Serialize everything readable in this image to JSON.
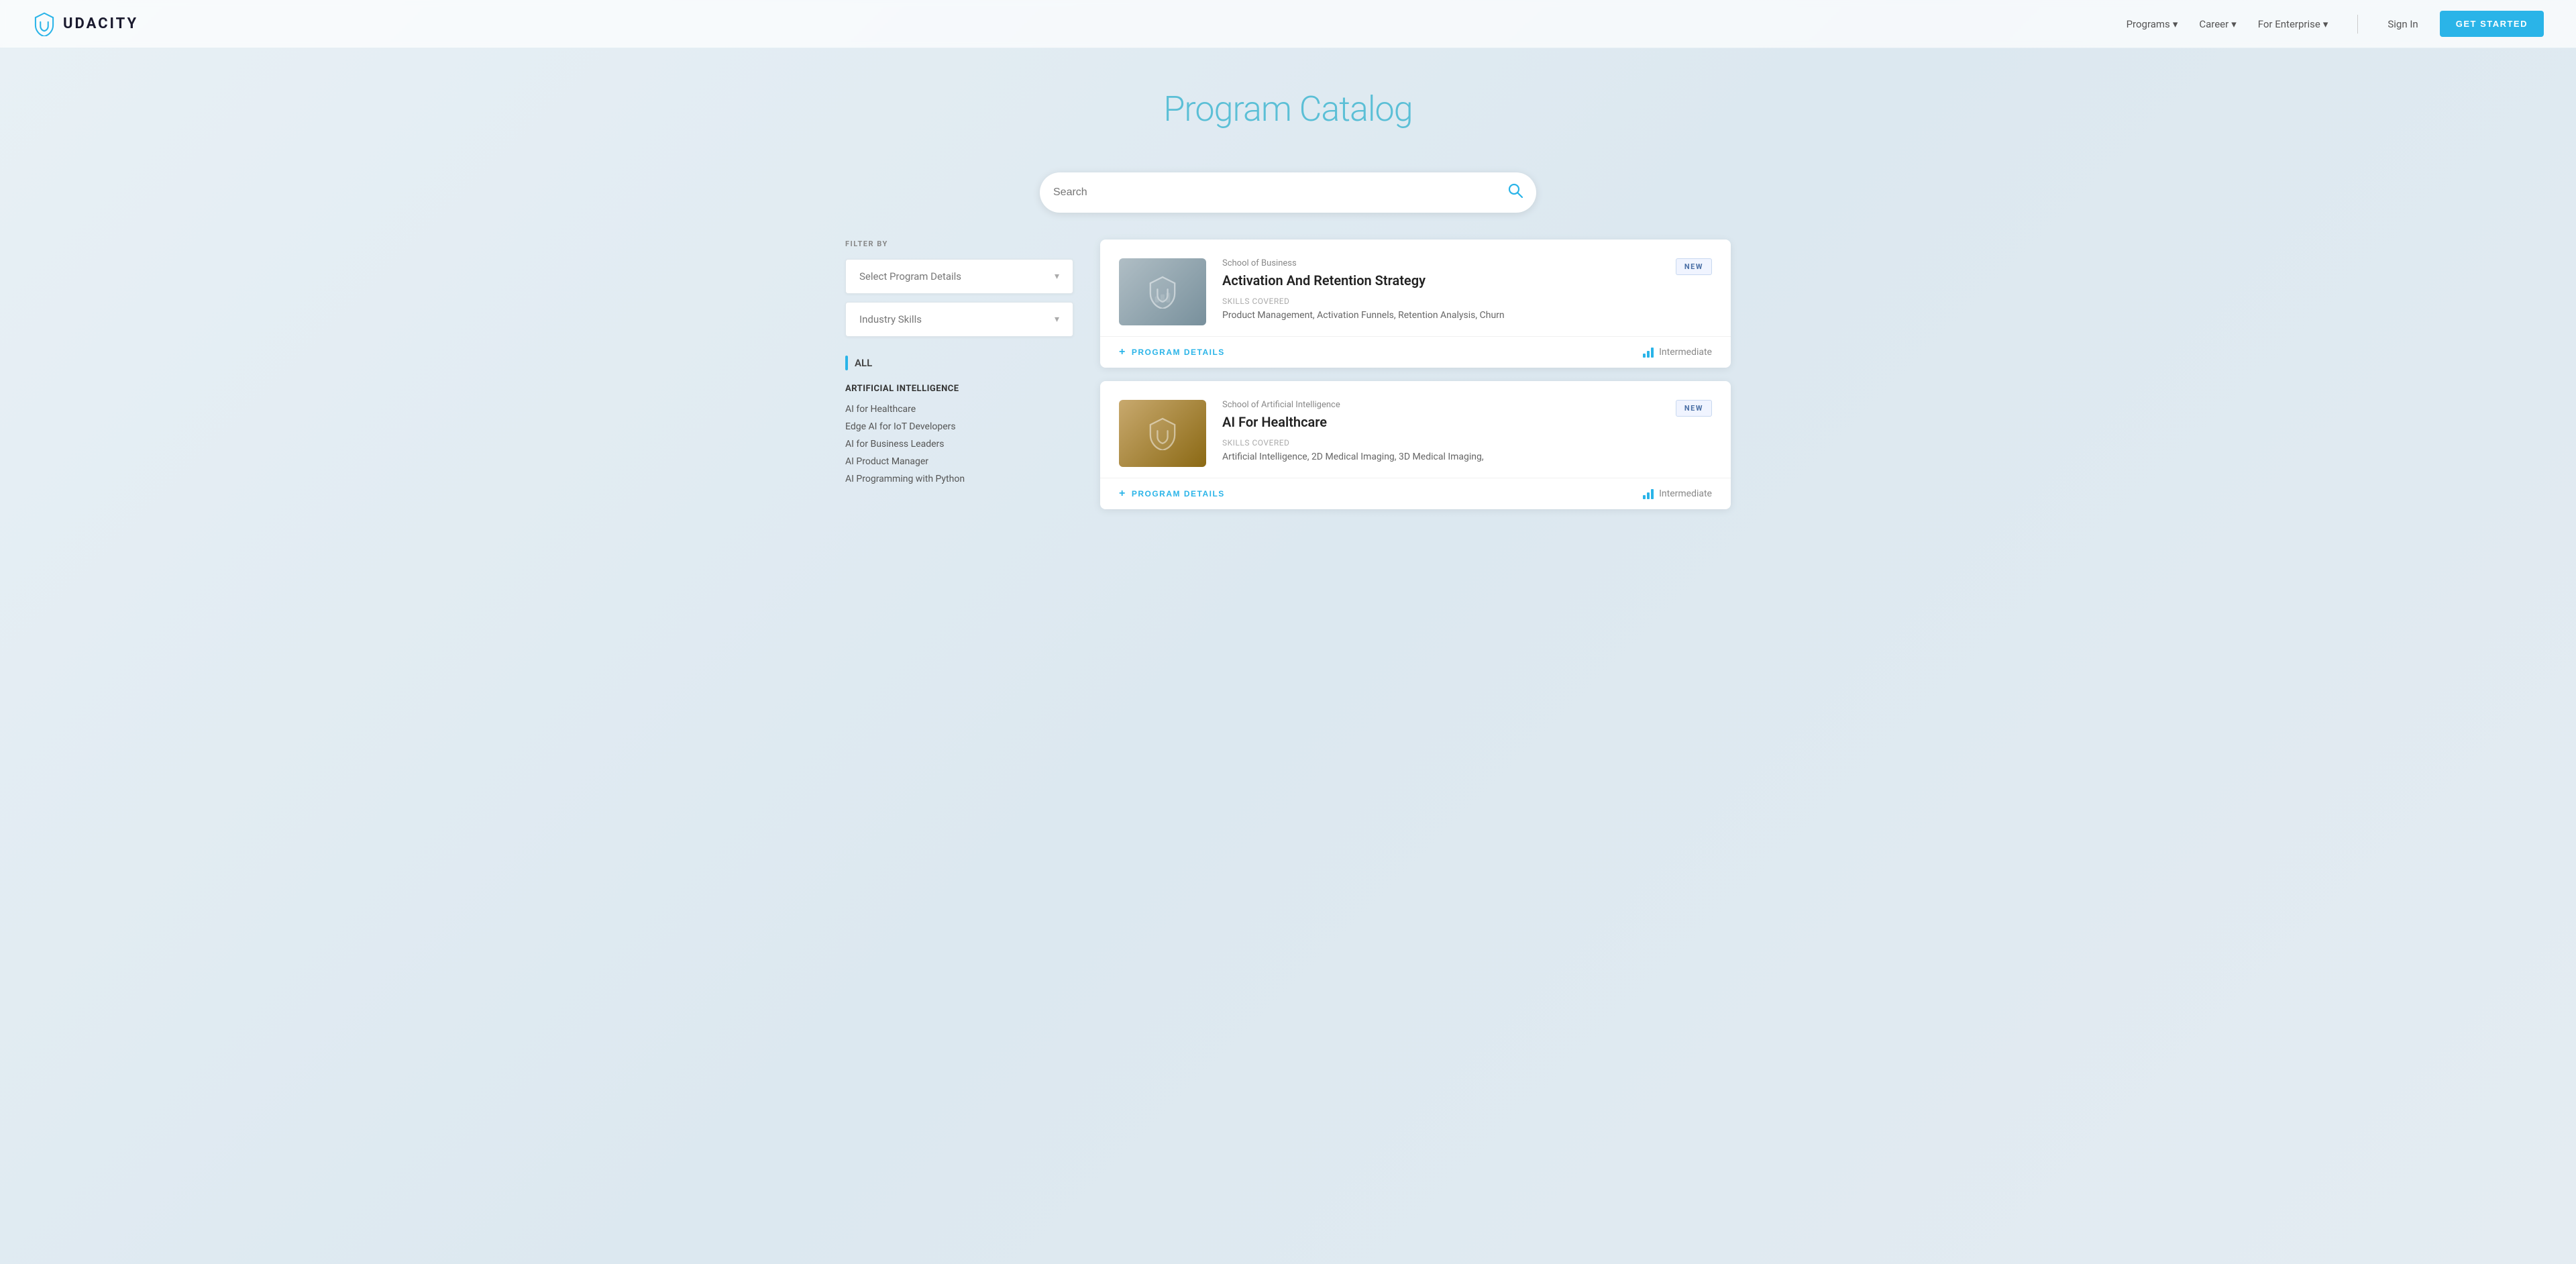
{
  "nav": {
    "logo_text": "UDACITY",
    "links": [
      {
        "label": "Programs",
        "has_dropdown": true
      },
      {
        "label": "Career",
        "has_dropdown": true
      },
      {
        "label": "For Enterprise",
        "has_dropdown": true
      }
    ],
    "signin_label": "Sign In",
    "cta_label": "GET STARTED"
  },
  "hero": {
    "title": "Program Catalog"
  },
  "search": {
    "placeholder": "Search"
  },
  "sidebar": {
    "filter_label": "FILTER BY",
    "select_program_details": "Select Program Details",
    "industry_skills": "Industry Skills",
    "all_label": "ALL",
    "categories": [
      {
        "title": "ARTIFICIAL INTELLIGENCE",
        "items": [
          "AI for Healthcare",
          "Edge AI for IoT Developers",
          "AI for Business Leaders",
          "AI Product Manager",
          "AI Programming with Python"
        ]
      }
    ]
  },
  "programs": [
    {
      "school": "School of Business",
      "title": "Activation And Retention Strategy",
      "badge": "NEW",
      "skills_label": "Skills Covered",
      "skills": "Product Management, Activation Funnels, Retention Analysis, Churn",
      "details_btn": "PROGRAM DETAILS",
      "level": "Intermediate",
      "thumb_type": "business"
    },
    {
      "school": "School of Artificial Intelligence",
      "title": "AI For Healthcare",
      "badge": "NEW",
      "skills_label": "Skills Covered",
      "skills": "Artificial Intelligence, 2D Medical Imaging, 3D Medical Imaging,",
      "details_btn": "PROGRAM DETAILS",
      "level": "Intermediate",
      "thumb_type": "ai"
    }
  ]
}
